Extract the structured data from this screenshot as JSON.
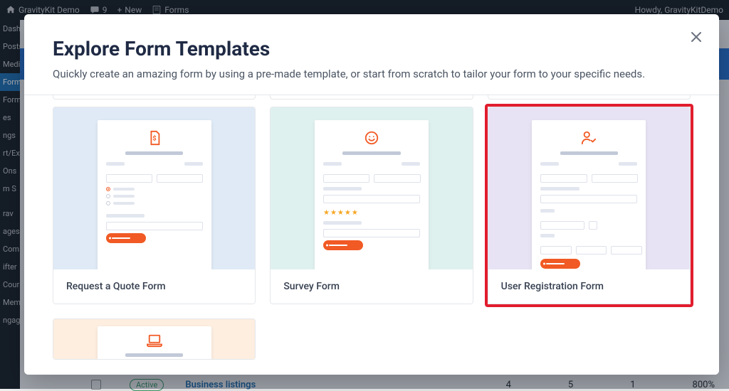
{
  "admin_bar": {
    "site_title": "GravityKit Demo",
    "comments_count": "9",
    "new_label": "New",
    "forms_label": "Forms",
    "howdy": "Howdy, GravityKitDemo"
  },
  "sidebar": {
    "items": [
      {
        "label": "Dashboard"
      },
      {
        "label": "Posts"
      },
      {
        "label": "Media"
      },
      {
        "label": "Forms"
      },
      {
        "label": "Forms"
      },
      {
        "label": "es"
      },
      {
        "label": "ngs"
      },
      {
        "label": "rt/Ex"
      },
      {
        "label": "Ons"
      },
      {
        "label": "m S"
      },
      {
        "label": "rav"
      },
      {
        "label": "ages"
      },
      {
        "label": "Com"
      },
      {
        "label": "ifter"
      },
      {
        "label": "Cour"
      },
      {
        "label": "Mem"
      },
      {
        "label": "ngagements"
      }
    ]
  },
  "modal": {
    "title": "Explore Form Templates",
    "subtitle": "Quickly create an amazing form by using a pre-made template, or start from scratch to tailor your form to your specific needs.",
    "templates": [
      {
        "label": "Request a Quote Form",
        "icon": "document-dollar-icon"
      },
      {
        "label": "Survey Form",
        "icon": "smiley-icon"
      },
      {
        "label": "User Registration Form",
        "icon": "user-check-icon"
      },
      {
        "label": "",
        "icon": "laptop-icon"
      }
    ]
  },
  "bg_table": {
    "status": "Active",
    "name": "Business listings",
    "cols": [
      "4",
      "5",
      "1",
      "800%"
    ]
  }
}
